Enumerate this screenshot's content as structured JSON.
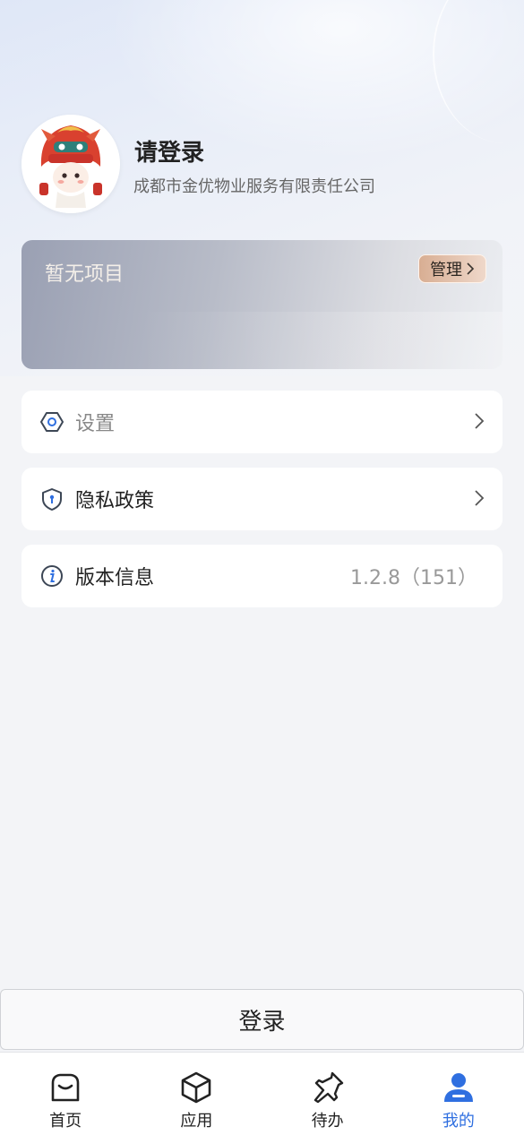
{
  "profile": {
    "name": "请登录",
    "company": "成都市金优物业服务有限责任公司"
  },
  "project": {
    "title": "暂无项目",
    "manage_label": "管理"
  },
  "menu": [
    {
      "label": "设置",
      "icon": "settings-icon"
    },
    {
      "label": "隐私政策",
      "icon": "shield-icon"
    },
    {
      "label": "版本信息",
      "icon": "info-icon",
      "value": "1.2.8（151）"
    }
  ],
  "login_label": "登录",
  "tabs": [
    {
      "label": "首页",
      "icon": "home-icon"
    },
    {
      "label": "应用",
      "icon": "cube-icon"
    },
    {
      "label": "待办",
      "icon": "pin-icon"
    },
    {
      "label": "我的",
      "icon": "user-icon",
      "active": true
    }
  ],
  "colors": {
    "accent": "#2f6fe0",
    "manage_btn": "#d8ae93"
  }
}
